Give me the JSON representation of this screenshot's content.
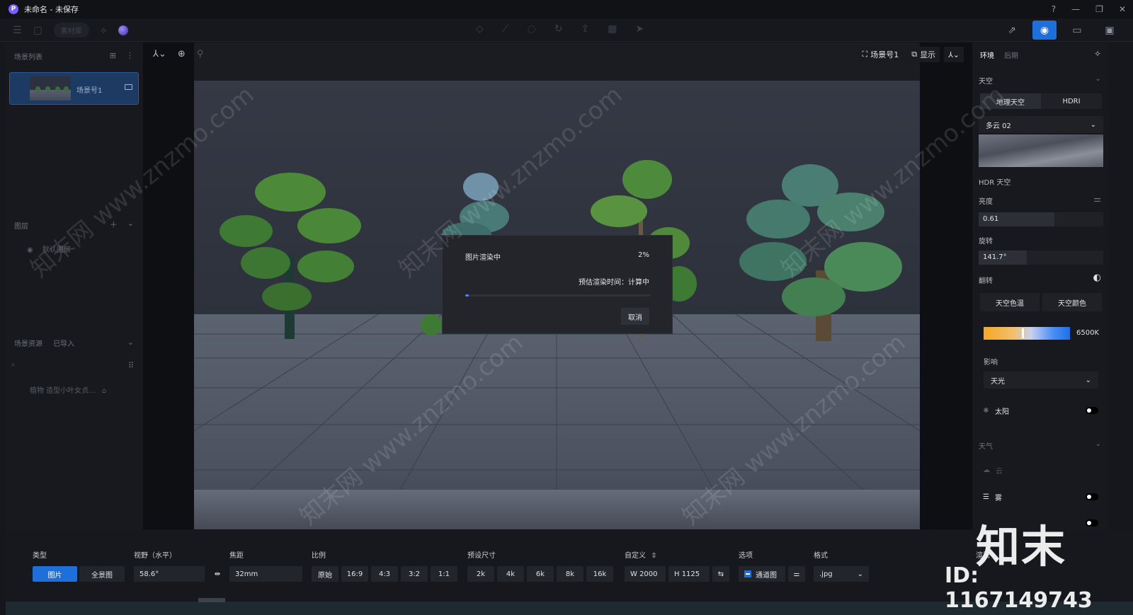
{
  "window": {
    "title": "未命名 - 未保存",
    "app_icon_letter": "P",
    "controls": [
      "?",
      "—",
      "❐",
      "✕"
    ]
  },
  "toolbar": {
    "material_lib": "素材库",
    "right_buttons": [
      "export-icon",
      "camera-icon",
      "video-icon",
      "gallery-icon"
    ]
  },
  "left": {
    "scene_list_title": "场景列表",
    "scene_card_label": "场景号1",
    "layers_title": "图层",
    "default_layer": "默认图层",
    "assets_title": "场景资源",
    "assets_sub": "已导入",
    "asset_item": "植物 造型小叶女贞..."
  },
  "viewport": {
    "scene_button": "场景号1",
    "display_button": "显示"
  },
  "dialog": {
    "title": "图片渲染中",
    "percent_text": "2%",
    "progress": 0.02,
    "eta": "预估渲染时间：计算中",
    "cancel": "取消"
  },
  "right": {
    "tabs": [
      "环境",
      "后期"
    ],
    "sky_title": "天空",
    "sky_modes": [
      "地理天空",
      "HDRI"
    ],
    "sky_preset": "多云 02",
    "hdr_label": "HDR 天空",
    "brightness_label": "亮度",
    "brightness_value": "0.61",
    "brightness": 0.61,
    "rotation_label": "旋转",
    "rotation_value": "141.7°",
    "flip_label": "翻转",
    "sky_options": [
      "天空色温",
      "天空颜色"
    ],
    "temperature": "6500K",
    "influence_label": "影响",
    "influence_value": "天光",
    "sun_label": "太阳",
    "weather_title": "天气",
    "cloud_label": "云",
    "fog_label": "雾"
  },
  "bottom": {
    "type_label": "类型",
    "type_options": [
      "图片",
      "全景图"
    ],
    "fov_label": "视野（水平）",
    "fov_value": "58.6°",
    "focal_label": "焦距",
    "focal_value": "32mm",
    "ratio_label": "比例",
    "ratios": [
      "原始",
      "16:9",
      "4:3",
      "3:2",
      "1:1"
    ],
    "preset_label": "预设尺寸",
    "presets": [
      "2k",
      "4k",
      "6k",
      "8k",
      "16k"
    ],
    "custom_label": "自定义",
    "width": "W  2000",
    "height": "H  1125",
    "options_label": "选项",
    "channel_label": "通道图",
    "format_label": "格式",
    "format_value": ".jpg",
    "render_label": "渲染"
  },
  "watermark": {
    "brand": "知末",
    "id": "ID: 1167149743",
    "site": "知末网 www.znzmo.com"
  },
  "colors": {
    "accent": "#1e6fd9",
    "progress": "#5d7dff"
  }
}
